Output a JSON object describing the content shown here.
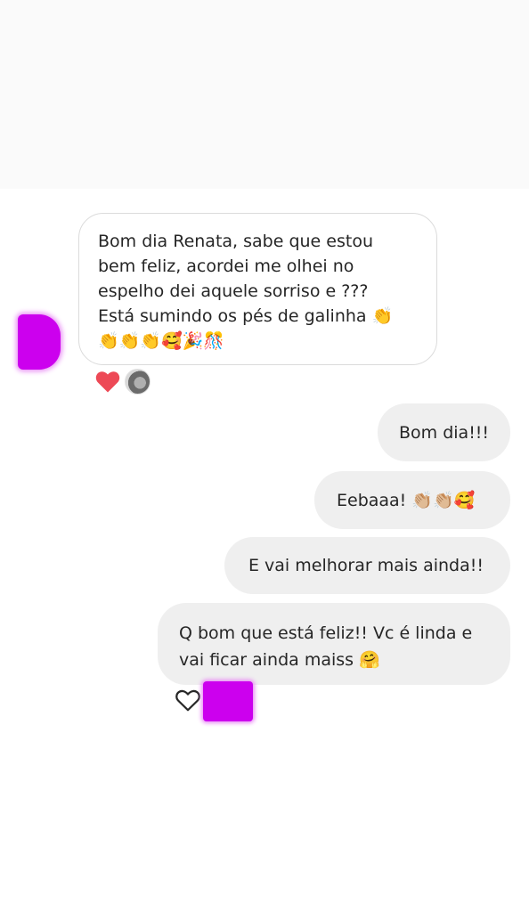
{
  "conversation": {
    "incoming_message": {
      "lines": [
        "Bom dia Renata,  sabe que estou",
        "bem feliz,  acordei me olhei no",
        "espelho dei aquele sorriso e  ???",
        "Está sumindo os pés de galinha 👏",
        "👏👏👏🥰🎉🎊"
      ],
      "reaction": "red-heart-icon"
    },
    "outgoing_messages": [
      {
        "text": "Bom dia!!!"
      },
      {
        "text": "Eebaaa! 👏🏼👏🏼🥰"
      },
      {
        "text": "E vai melhorar mais ainda!!"
      },
      {
        "lines": [
          "Q bom que está feliz!! Vc é linda e",
          "vai ficar ainda maiss 🤗"
        ]
      }
    ],
    "like_icon": "outline-heart-icon"
  },
  "colors": {
    "incoming_bubble_border": "#dbdbdb",
    "outgoing_bubble_bg": "#efefef",
    "reaction_heart": "#ed4956",
    "blur_censor": "#cc00ee"
  }
}
